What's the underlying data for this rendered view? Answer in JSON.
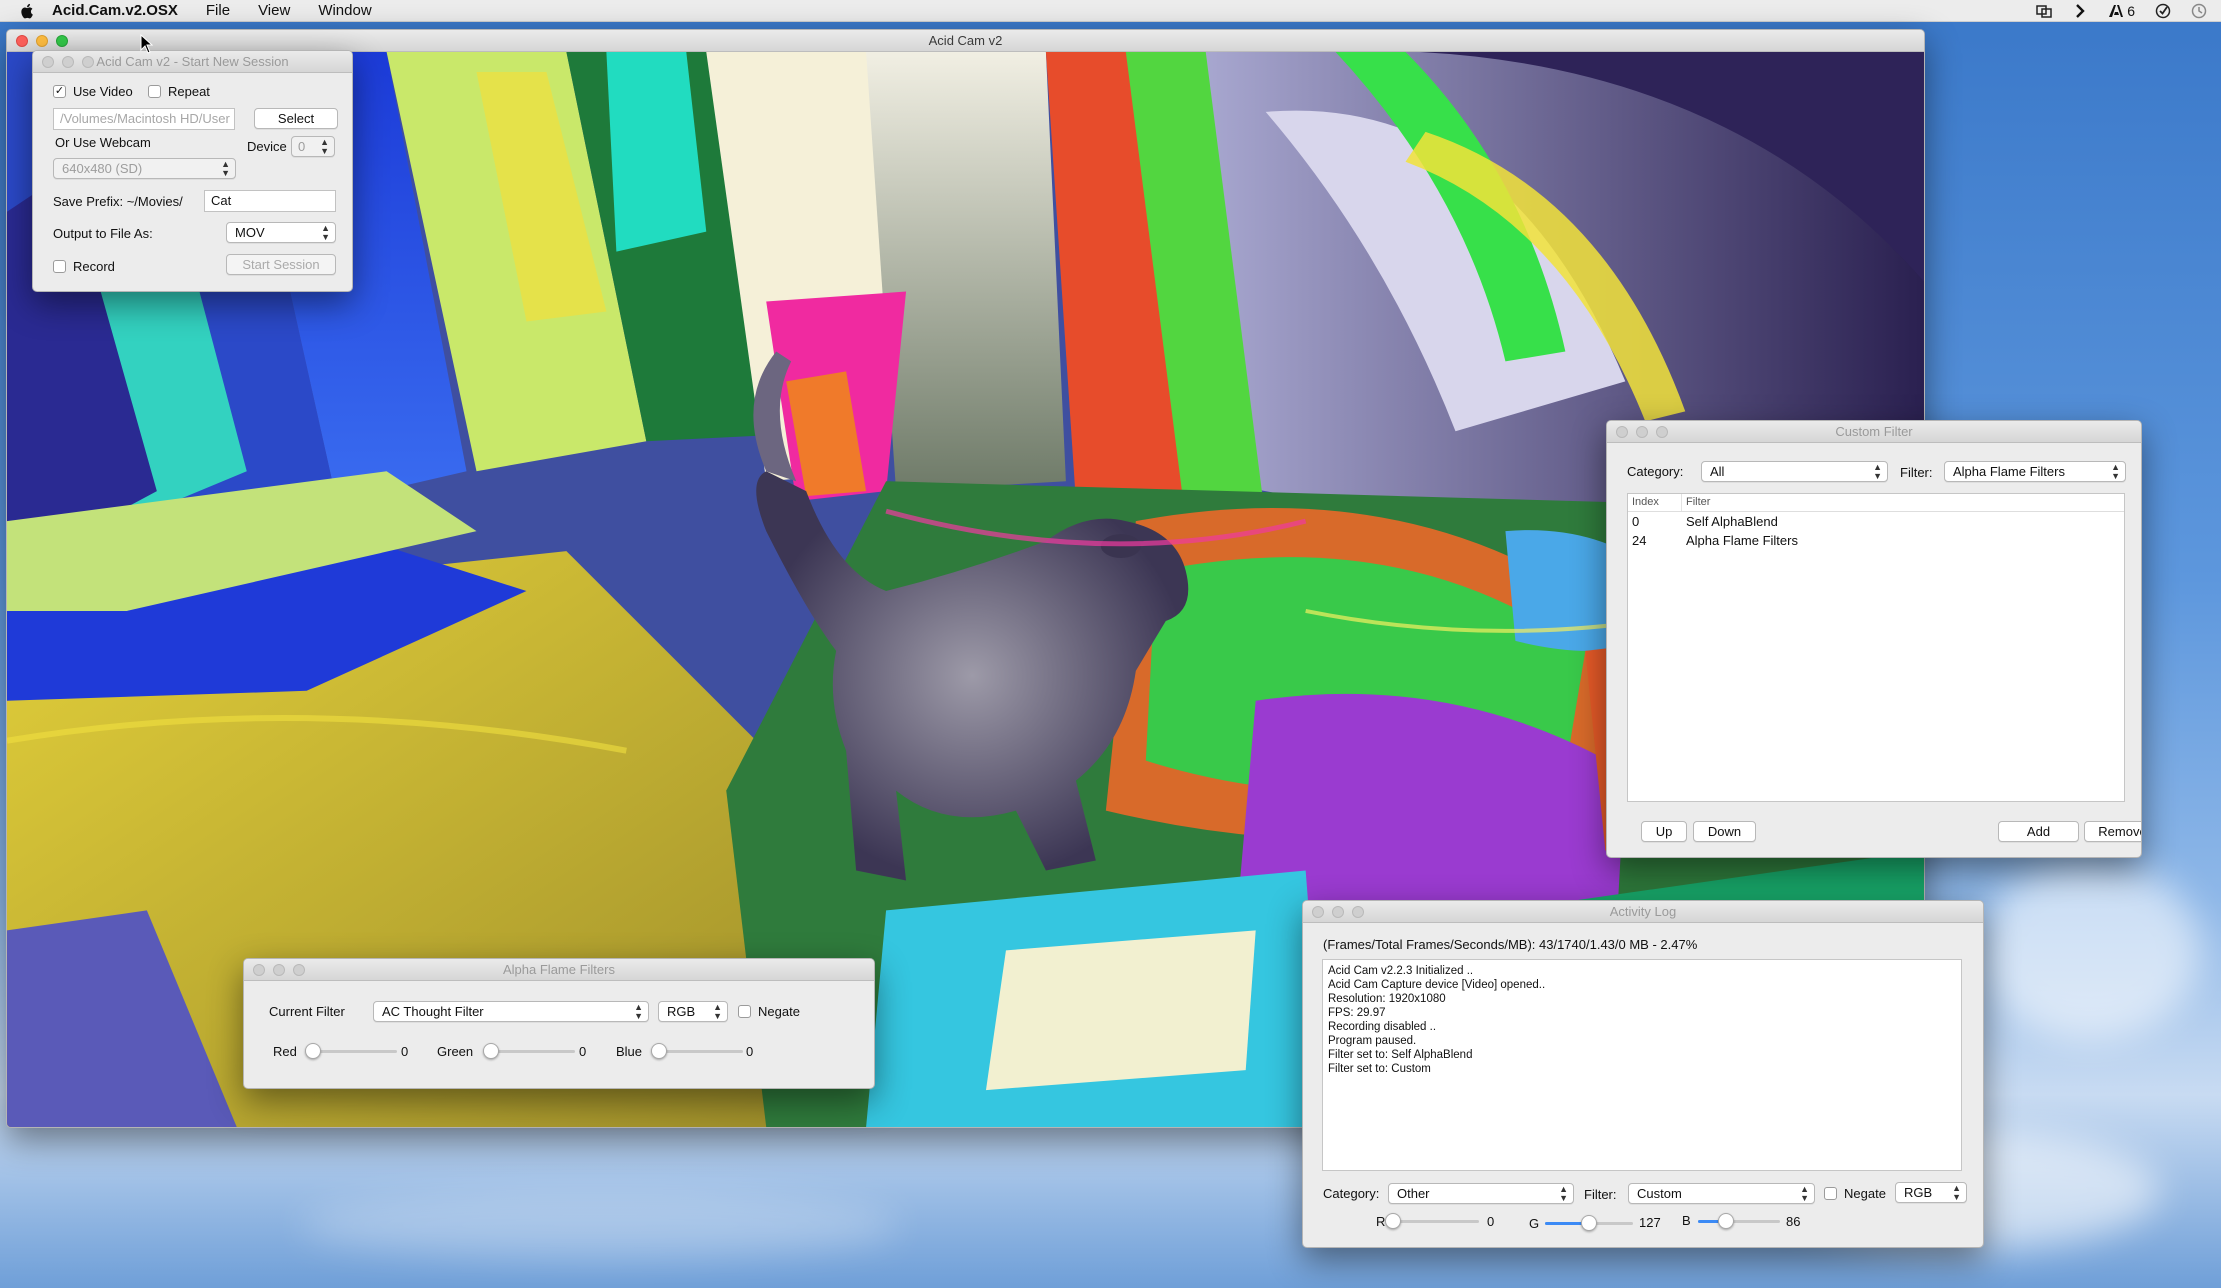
{
  "menubar": {
    "app_name": "Acid.Cam.v2.OSX",
    "menus": [
      "File",
      "View",
      "Window"
    ],
    "status_count": "6"
  },
  "main_window": {
    "title": "Acid Cam v2"
  },
  "session_window": {
    "title": "Acid Cam v2 - Start New Session",
    "use_video_label": "Use Video",
    "use_video_checked": true,
    "repeat_label": "Repeat",
    "repeat_checked": false,
    "video_path": "/Volumes/Macintosh HD/User",
    "select_label": "Select",
    "webcam_label": "Or Use Webcam",
    "device_label": "Device",
    "device_value": "0",
    "resolution_value": "640x480 (SD)",
    "save_prefix_label": "Save Prefix: ~/Movies/",
    "save_prefix_value": "Cat",
    "output_label": "Output to File As:",
    "output_value": "MOV",
    "record_label": "Record",
    "record_checked": false,
    "start_label": "Start Session"
  },
  "custom_window": {
    "title": "Custom Filter",
    "category_label": "Category:",
    "category_value": "All",
    "filter_label": "Filter:",
    "filter_value": "Alpha Flame Filters",
    "columns": [
      "Index",
      "Filter"
    ],
    "rows": [
      {
        "index": "0",
        "filter": "Self AlphaBlend"
      },
      {
        "index": "24",
        "filter": "Alpha Flame Filters"
      }
    ],
    "up_label": "Up",
    "down_label": "Down",
    "add_label": "Add",
    "remove_label": "Remove"
  },
  "log_window": {
    "title": "Activity Log",
    "stats": "(Frames/Total Frames/Seconds/MB): 43/1740/1.43/0 MB - 2.47%",
    "lines": [
      "Acid Cam v2.2.3 Initialized ..",
      "Acid Cam Capture device [Video] opened..",
      "Resolution: 1920x1080",
      "FPS: 29.97",
      "Recording disabled ..",
      "Program paused.",
      "Filter set to: Self AlphaBlend",
      "Filter set to: Custom"
    ],
    "category_label": "Category:",
    "category_value": "Other",
    "filter_label": "Filter:",
    "filter_value": "Custom",
    "negate_label": "Negate",
    "negate_checked": false,
    "color_mode": "RGB",
    "r_label": "R",
    "r_value": "0",
    "g_label": "G",
    "g_value": "127",
    "b_label": "B",
    "b_value": "86",
    "r_level": 0,
    "g_level": 0.5,
    "b_level": 0.34
  },
  "alpha_window": {
    "title": "Alpha Flame Filters",
    "current_filter_label": "Current Filter",
    "current_filter_value": "AC Thought Filter",
    "color_mode": "RGB",
    "negate_label": "Negate",
    "negate_checked": false,
    "red_label": "Red",
    "red_value": "0",
    "green_label": "Green",
    "green_value": "0",
    "blue_label": "Blue",
    "blue_value": "0"
  },
  "colors": {
    "accent": "#3b8af5"
  }
}
